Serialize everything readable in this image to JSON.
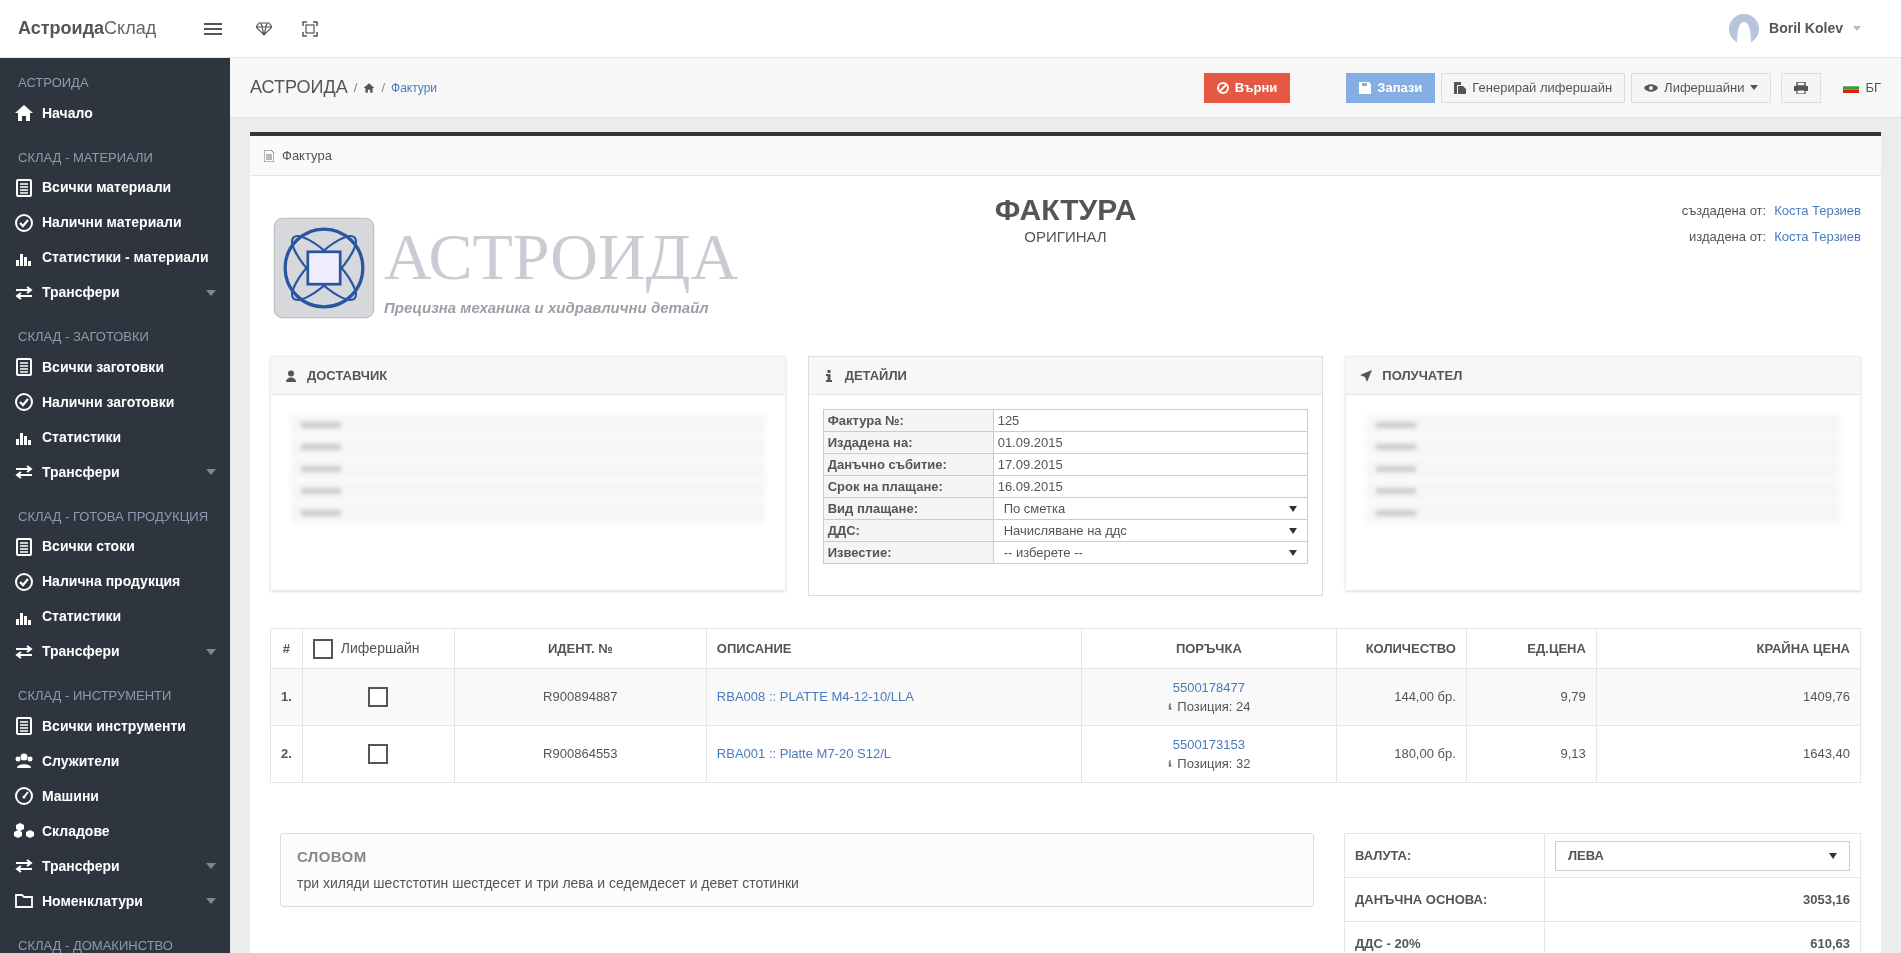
{
  "header": {
    "brand_bold": "Астроида",
    "brand_light": "Склад",
    "user": "Boril Kolev"
  },
  "sidebar": [
    {
      "title": "АСТРОИДА",
      "items": [
        {
          "label": "Начало",
          "kind": "home",
          "caret": false
        }
      ]
    },
    {
      "title": "СКЛАД - МАТЕРИАЛИ",
      "items": [
        {
          "label": "Всички материали",
          "kind": "stack",
          "caret": false
        },
        {
          "label": "Налични материали",
          "kind": "check",
          "caret": false
        },
        {
          "label": "Статистики - материали",
          "kind": "chart",
          "caret": false
        },
        {
          "label": "Трансфери",
          "kind": "transfer",
          "caret": true
        }
      ]
    },
    {
      "title": "СКЛАД - ЗАГОТОВКИ",
      "items": [
        {
          "label": "Всички заготовки",
          "kind": "stack",
          "caret": false
        },
        {
          "label": "Налични заготовки",
          "kind": "check",
          "caret": false
        },
        {
          "label": "Статистики",
          "kind": "chart",
          "caret": false
        },
        {
          "label": "Трансфери",
          "kind": "transfer",
          "caret": true
        }
      ]
    },
    {
      "title": "СКЛАД - ГОТОВА ПРОДУКЦИЯ",
      "items": [
        {
          "label": "Всички стоки",
          "kind": "stack",
          "caret": false
        },
        {
          "label": "Налична продукция",
          "kind": "check",
          "caret": false
        },
        {
          "label": "Статистики",
          "kind": "chart",
          "caret": false
        },
        {
          "label": "Трансфери",
          "kind": "transfer",
          "caret": true
        }
      ]
    },
    {
      "title": "СКЛАД - ИНСТРУМЕНТИ",
      "items": [
        {
          "label": "Всички инструменти",
          "kind": "stack",
          "caret": false
        },
        {
          "label": "Служители",
          "kind": "users",
          "caret": false
        },
        {
          "label": "Машини",
          "kind": "gauge",
          "caret": false
        },
        {
          "label": "Складове",
          "kind": "cubes",
          "caret": false
        },
        {
          "label": "Трансфери",
          "kind": "transfer",
          "caret": true
        },
        {
          "label": "Номенклатури",
          "kind": "folder",
          "caret": true
        }
      ]
    },
    {
      "title": "СКЛАД - ДОМАКИНСТВО"
    }
  ],
  "breadcrumb": {
    "items": [
      "АСТРОИДА",
      "Фактури"
    ],
    "separators": [
      "/",
      "/"
    ]
  },
  "toolbar": [
    {
      "label": "Върни",
      "kind": "danger"
    },
    {
      "label": "Запази",
      "kind": "primary"
    },
    {
      "label": "Генерирай лифершайн",
      "kind": "copy"
    },
    {
      "label": "Лифершайни",
      "kind": "dropdown"
    },
    {
      "kind": "print"
    }
  ],
  "language": "БГ",
  "card_title": "Фактура",
  "logo": {
    "name": "АСТРОИДА",
    "tagline": "Прецизна механика и хидравлични детайл"
  },
  "invoice": {
    "title": "ФАКТУРА",
    "subtitle": "ОРИГИНАЛ",
    "meta": [
      {
        "label": "създадена от:",
        "value": "Коста Терзиев"
      },
      {
        "label": "издадена от:",
        "value": "Коста Терзиев"
      }
    ]
  },
  "panels": {
    "supplier": "ДОСТАВЧИК",
    "details": "ДЕТАЙЛИ",
    "recipient": "ПОЛУЧАТЕЛ"
  },
  "details": [
    {
      "label": "Фактура №:",
      "value": "125",
      "kind": "text"
    },
    {
      "label": "Издадена на:",
      "value": "01.09.2015",
      "kind": "text"
    },
    {
      "label": "Данъчно събитие:",
      "value": "17.09.2015",
      "kind": "text"
    },
    {
      "label": "Срок на плащане:",
      "value": "16.09.2015",
      "kind": "text"
    },
    {
      "label": "Вид плащане:",
      "value": "По сметка",
      "kind": "select"
    },
    {
      "label": "ДДС:",
      "value": "Начисляване на ддс",
      "kind": "select"
    },
    {
      "label": "Известие:",
      "value": "-- изберете --",
      "kind": "select"
    }
  ],
  "table": {
    "columns": [
      "#",
      "Лифершайн",
      "ИДЕНТ. №",
      "ОПИСАНИЕ",
      "ПОРЪЧКА",
      "КОЛИЧЕСТВО",
      "ЕД.ЦЕНА",
      "КРАЙНА ЦЕНА"
    ],
    "all_checked": false,
    "rows": [
      {
        "num": "1.",
        "checked": false,
        "ident": "R900894887",
        "description": "RBA008 :: PLATTE M4-12-10/LLA",
        "order": "5500178477",
        "position": "Позиция: 24",
        "qty": "144,00 бр.",
        "price": "9,79",
        "total": "1409,76"
      },
      {
        "num": "2.",
        "checked": false,
        "ident": "R900864553",
        "description": "RBA001 :: Platte M7-20 S12/L",
        "order": "5500173153",
        "position": "Позиция: 32",
        "qty": "180,00 бр.",
        "price": "9,13",
        "total": "1643,40"
      }
    ]
  },
  "words": {
    "title": "СЛОВОМ",
    "text": "три хиляди шестстотин шестдесет и три лева и седемдесет и девет стотинки"
  },
  "totals": [
    {
      "label": "ВАЛУТА:",
      "value": "ЛЕВА",
      "kind": "select"
    },
    {
      "label": "ДАНЪЧНА ОСНОВА:",
      "value": "3053,16",
      "kind": "text"
    },
    {
      "label": "ДДС - 20%",
      "value": "610,63",
      "kind": "text"
    }
  ]
}
